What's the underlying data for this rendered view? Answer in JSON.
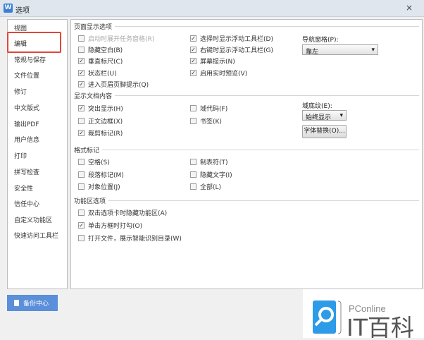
{
  "window": {
    "title": "选项",
    "app_icon": "W",
    "close": "×"
  },
  "sidebar": {
    "items": [
      "视图",
      "编辑",
      "常规与保存",
      "文件位置",
      "修订",
      "中文版式",
      "输出PDF",
      "用户信息",
      "打印",
      "拼写检查",
      "安全性",
      "信任中心",
      "自定义功能区",
      "快速访问工具栏"
    ],
    "selected": "编辑"
  },
  "page_display": {
    "title": "页面显示选项",
    "left": [
      {
        "label": "启动时展开任务窗格(R)",
        "checked": false,
        "disabled": true
      },
      {
        "label": "隐藏空白(B)",
        "checked": false
      },
      {
        "label": "垂直标尺(C)",
        "checked": true
      },
      {
        "label": "状态栏(U)",
        "checked": true
      },
      {
        "label": "进入页眉页脚提示(Q)",
        "checked": true
      }
    ],
    "right": [
      {
        "label": "选择时显示浮动工具栏(D)",
        "checked": true
      },
      {
        "label": "右键时显示浮动工具栏(G)",
        "checked": true
      },
      {
        "label": "屏幕提示(N)",
        "checked": true
      },
      {
        "label": "启用实时预览(V)",
        "checked": true
      }
    ],
    "nav_pane_label": "导航窗格(P):",
    "nav_pane_value": "靠左"
  },
  "doc_content": {
    "title": "显示文档内容",
    "left": [
      {
        "label": "突出显示(H)",
        "checked": true
      },
      {
        "label": "正文边框(X)",
        "checked": false
      },
      {
        "label": "裁剪标记(R)",
        "checked": true
      }
    ],
    "right": [
      {
        "label": "域代码(F)",
        "checked": false
      },
      {
        "label": "书签(K)",
        "checked": false
      }
    ],
    "shading_label": "域底纹(E):",
    "shading_value": "始终显示",
    "font_replace": "字体替换(O)..."
  },
  "format_marks": {
    "title": "格式标记",
    "left": [
      {
        "label": "空格(S)",
        "checked": false
      },
      {
        "label": "段落标记(M)",
        "checked": false
      },
      {
        "label": "对象位置(J)",
        "checked": false
      }
    ],
    "right": [
      {
        "label": "制表符(T)",
        "checked": false
      },
      {
        "label": "隐藏文字(I)",
        "checked": false
      },
      {
        "label": "全部(L)",
        "checked": false
      }
    ]
  },
  "ribbon": {
    "title": "功能区选项",
    "items": [
      {
        "label": "双击选项卡时隐藏功能区(A)",
        "checked": false
      },
      {
        "label": "单击方框时打勾(O)",
        "checked": true
      },
      {
        "label": "打开文件，展示智能识别目录(W)",
        "checked": false
      }
    ]
  },
  "footer": {
    "backup": "备份中心"
  },
  "watermark": {
    "brand": "PConline",
    "name": "IT百科",
    "color": "#2d9be8"
  }
}
